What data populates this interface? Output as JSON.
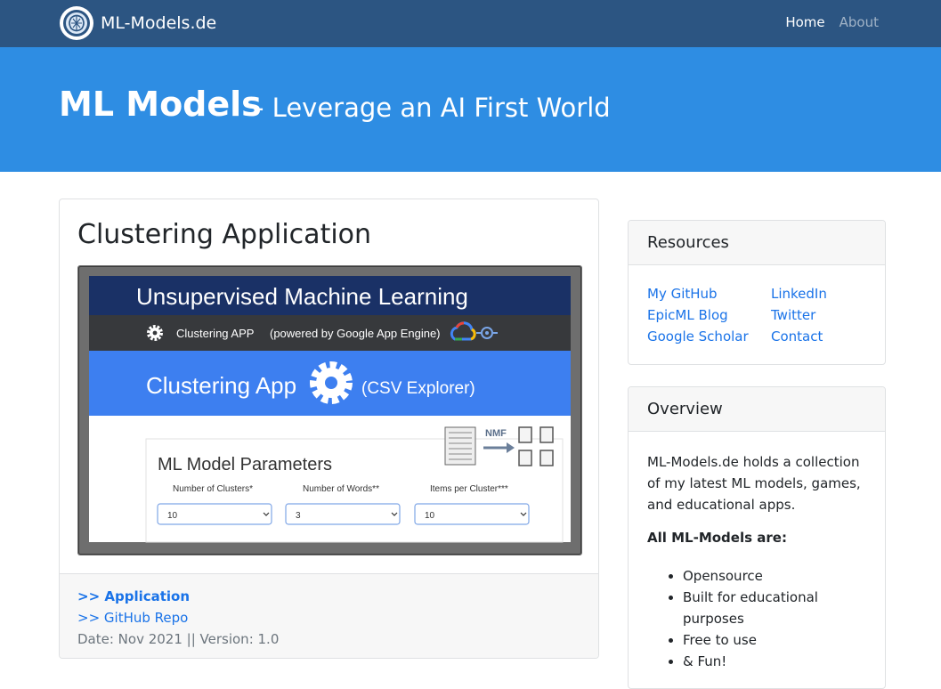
{
  "nav": {
    "brand": "ML-Models.de",
    "links": [
      {
        "label": "Home"
      },
      {
        "label": "About"
      }
    ]
  },
  "hero": {
    "title": "ML Models",
    "subtitle": "- Leverage an AI First World"
  },
  "post": {
    "title": "Clustering Application",
    "image": {
      "banner_title": "Unsupervised Machine Learning",
      "app_line": "Clustering APP",
      "powered_by": "(powered by Google App Engine)",
      "app_title": "Clustering App",
      "app_subtitle": "(CSV Explorer)",
      "nmf_label": "NMF",
      "params_title": "ML Model Parameters",
      "params": [
        {
          "label": "Number of Clusters*",
          "value": "10"
        },
        {
          "label": "Number of Words**",
          "value": "3"
        },
        {
          "label": "Items per Cluster***",
          "value": "10"
        }
      ]
    },
    "links": [
      {
        "label": ">> Application"
      },
      {
        "label": ">> GitHub Repo"
      }
    ],
    "meta": "Date: Nov 2021 || Version: 1.0"
  },
  "resources": {
    "title": "Resources",
    "left_links": [
      "My GitHub",
      "EpicML Blog",
      "Google Scholar"
    ],
    "right_links": [
      "LinkedIn",
      "Twitter",
      "Contact"
    ]
  },
  "overview": {
    "title": "Overview",
    "text": "ML-Models.de holds a collection of my latest ML models, games, and educational apps.",
    "bold": "All ML-Models are:",
    "items": [
      "Opensource",
      "Built for educational purposes",
      "Free to use",
      "& Fun!"
    ]
  },
  "colors": {
    "navbar": "#2c5582",
    "hero": "#2e8de3",
    "link": "#1a73e8",
    "banner_navy": "#1a3166",
    "banner_blue": "#3d7ff0"
  }
}
